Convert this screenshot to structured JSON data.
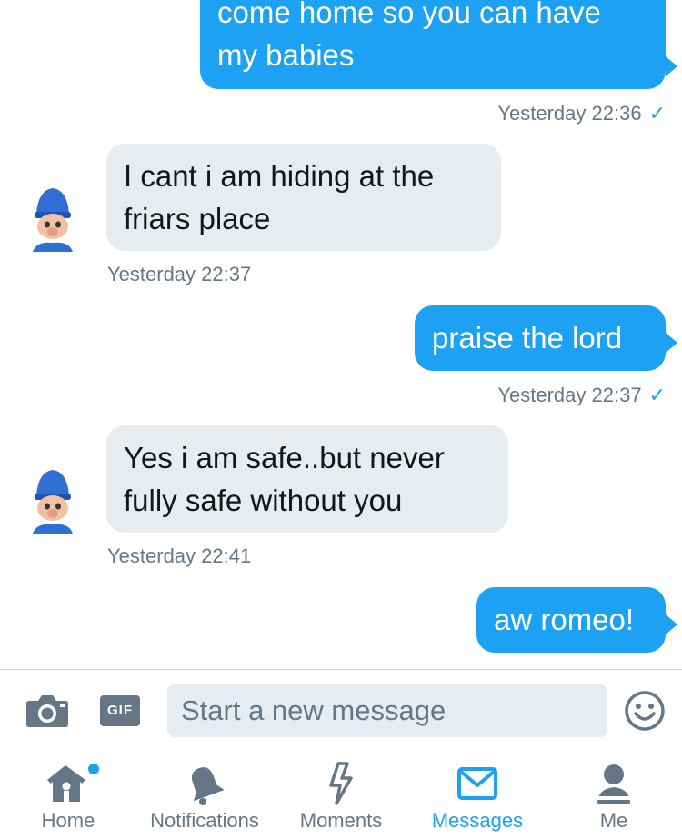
{
  "messages": [
    {
      "id": "m1",
      "direction": "out",
      "lines": [
        "come home so you can have",
        "my babies"
      ],
      "timestamp": "Yesterday 22:36",
      "read": true
    },
    {
      "id": "m2",
      "direction": "in",
      "lines": [
        "I cant i am hiding at the",
        "friars place"
      ],
      "timestamp": "Yesterday 22:37"
    },
    {
      "id": "m3",
      "direction": "out",
      "lines": [
        "praise the lord"
      ],
      "timestamp": "Yesterday 22:37",
      "read": true
    },
    {
      "id": "m4",
      "direction": "in",
      "lines": [
        "Yes i am safe..but never",
        "fully safe without you"
      ],
      "timestamp": "Yesterday 22:41"
    },
    {
      "id": "m5",
      "direction": "out",
      "lines": [
        "aw romeo!"
      ]
    }
  ],
  "composer": {
    "camera_icon": "camera-icon",
    "gif_label": "GIF",
    "placeholder": "Start a new message",
    "emoji_icon": "emoji-icon"
  },
  "tabs": [
    {
      "label": "Home",
      "icon": "home-icon",
      "badge": true
    },
    {
      "label": "Notifications",
      "icon": "bell-icon"
    },
    {
      "label": "Moments",
      "icon": "lightning-icon"
    },
    {
      "label": "Messages",
      "icon": "envelope-icon",
      "active": true
    },
    {
      "label": "Me",
      "icon": "person-icon"
    }
  ],
  "colors": {
    "accent": "#1DA1F2",
    "incoming_bubble": "#E6ECF0",
    "text_dark": "#14171A",
    "text_muted": "#657786",
    "icon_gray": "#657786"
  },
  "check_glyph": "✓"
}
